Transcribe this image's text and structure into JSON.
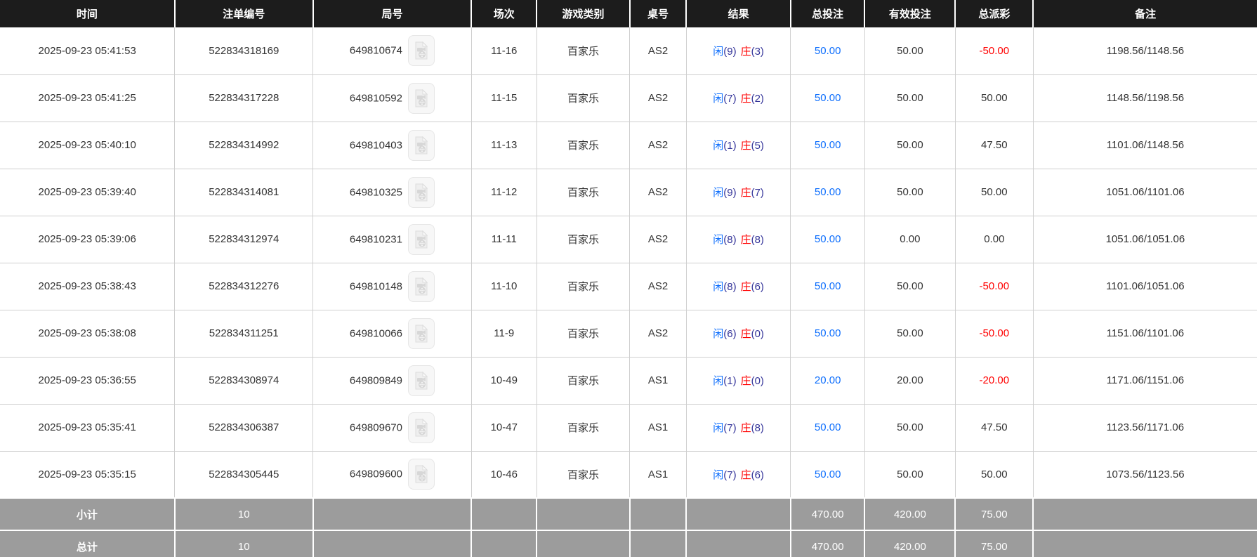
{
  "colors": {
    "header_bg": "#1c1c1c",
    "footer_bg": "#9c9c9c",
    "link_blue": "#0d6efd",
    "negative_red": "#ff0000",
    "score_navy": "#333399",
    "body_text": "#333333",
    "grid_line": "#cfcfcf"
  },
  "table": {
    "headers": [
      "时间",
      "注单编号",
      "局号",
      "场次",
      "游戏类别",
      "桌号",
      "结果",
      "总投注",
      "有效投注",
      "总派彩",
      "备注"
    ],
    "rows": [
      {
        "time": "2025-09-23 05:41:53",
        "bet_id": "522834318169",
        "round_id": "649810674",
        "session": "11-16",
        "game": "百家乐",
        "table": "AS2",
        "player_label": "闲",
        "player_score": "(9)",
        "banker_label": "庄",
        "banker_score": "(3)",
        "total_bet": "50.00",
        "valid_bet": "50.00",
        "payout": "-50.00",
        "remark": "1198.56/1148.56"
      },
      {
        "time": "2025-09-23 05:41:25",
        "bet_id": "522834317228",
        "round_id": "649810592",
        "session": "11-15",
        "game": "百家乐",
        "table": "AS2",
        "player_label": "闲",
        "player_score": "(7)",
        "banker_label": "庄",
        "banker_score": "(2)",
        "total_bet": "50.00",
        "valid_bet": "50.00",
        "payout": "50.00",
        "remark": "1148.56/1198.56"
      },
      {
        "time": "2025-09-23 05:40:10",
        "bet_id": "522834314992",
        "round_id": "649810403",
        "session": "11-13",
        "game": "百家乐",
        "table": "AS2",
        "player_label": "闲",
        "player_score": "(1)",
        "banker_label": "庄",
        "banker_score": "(5)",
        "total_bet": "50.00",
        "valid_bet": "50.00",
        "payout": "47.50",
        "remark": "1101.06/1148.56"
      },
      {
        "time": "2025-09-23 05:39:40",
        "bet_id": "522834314081",
        "round_id": "649810325",
        "session": "11-12",
        "game": "百家乐",
        "table": "AS2",
        "player_label": "闲",
        "player_score": "(9)",
        "banker_label": "庄",
        "banker_score": "(7)",
        "total_bet": "50.00",
        "valid_bet": "50.00",
        "payout": "50.00",
        "remark": "1051.06/1101.06"
      },
      {
        "time": "2025-09-23 05:39:06",
        "bet_id": "522834312974",
        "round_id": "649810231",
        "session": "11-11",
        "game": "百家乐",
        "table": "AS2",
        "player_label": "闲",
        "player_score": "(8)",
        "banker_label": "庄",
        "banker_score": "(8)",
        "total_bet": "50.00",
        "valid_bet": "0.00",
        "payout": "0.00",
        "remark": "1051.06/1051.06"
      },
      {
        "time": "2025-09-23 05:38:43",
        "bet_id": "522834312276",
        "round_id": "649810148",
        "session": "11-10",
        "game": "百家乐",
        "table": "AS2",
        "player_label": "闲",
        "player_score": "(8)",
        "banker_label": "庄",
        "banker_score": "(6)",
        "total_bet": "50.00",
        "valid_bet": "50.00",
        "payout": "-50.00",
        "remark": "1101.06/1051.06"
      },
      {
        "time": "2025-09-23 05:38:08",
        "bet_id": "522834311251",
        "round_id": "649810066",
        "session": "11-9",
        "game": "百家乐",
        "table": "AS2",
        "player_label": "闲",
        "player_score": "(6)",
        "banker_label": "庄",
        "banker_score": "(0)",
        "total_bet": "50.00",
        "valid_bet": "50.00",
        "payout": "-50.00",
        "remark": "1151.06/1101.06"
      },
      {
        "time": "2025-09-23 05:36:55",
        "bet_id": "522834308974",
        "round_id": "649809849",
        "session": "10-49",
        "game": "百家乐",
        "table": "AS1",
        "player_label": "闲",
        "player_score": "(1)",
        "banker_label": "庄",
        "banker_score": "(0)",
        "total_bet": "20.00",
        "valid_bet": "20.00",
        "payout": "-20.00",
        "remark": "1171.06/1151.06"
      },
      {
        "time": "2025-09-23 05:35:41",
        "bet_id": "522834306387",
        "round_id": "649809670",
        "session": "10-47",
        "game": "百家乐",
        "table": "AS1",
        "player_label": "闲",
        "player_score": "(7)",
        "banker_label": "庄",
        "banker_score": "(8)",
        "total_bet": "50.00",
        "valid_bet": "50.00",
        "payout": "47.50",
        "remark": "1123.56/1171.06"
      },
      {
        "time": "2025-09-23 05:35:15",
        "bet_id": "522834305445",
        "round_id": "649809600",
        "session": "10-46",
        "game": "百家乐",
        "table": "AS1",
        "player_label": "闲",
        "player_score": "(7)",
        "banker_label": "庄",
        "banker_score": "(6)",
        "total_bet": "50.00",
        "valid_bet": "50.00",
        "payout": "50.00",
        "remark": "1073.56/1123.56"
      }
    ],
    "subtotal": {
      "label": "小计",
      "count": "10",
      "total_bet": "470.00",
      "valid_bet": "420.00",
      "payout": "75.00"
    },
    "total": {
      "label": "总计",
      "count": "10",
      "total_bet": "470.00",
      "valid_bet": "420.00",
      "payout": "75.00"
    }
  },
  "icons": {
    "video_icon_name": "video-file-icon"
  }
}
